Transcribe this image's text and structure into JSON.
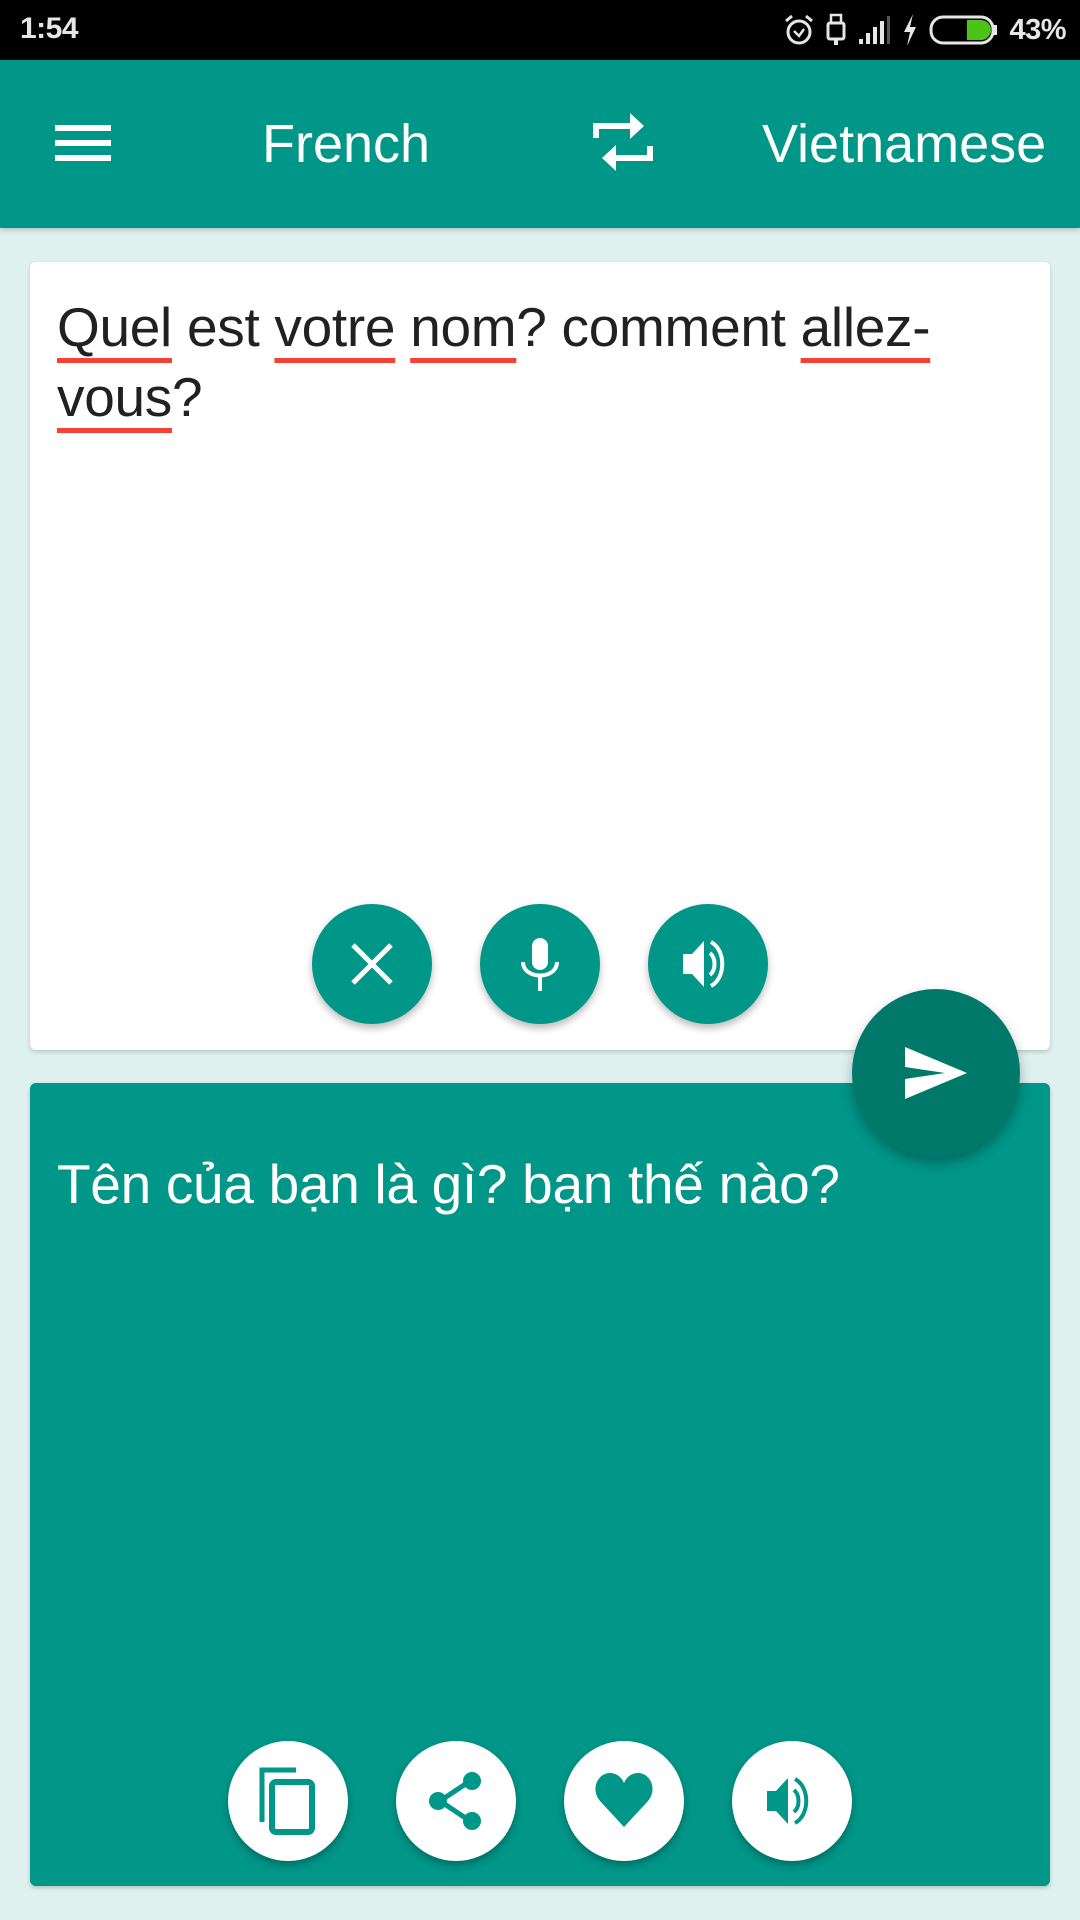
{
  "status_bar": {
    "time": "1:54",
    "icons": [
      "alarm-icon",
      "usb-icon",
      "signal-icon",
      "charging-icon",
      "battery-icon"
    ],
    "battery_percent": "43%",
    "battery_level": 0.43,
    "battery_color": "#4CC417"
  },
  "toolbar": {
    "menu_icon": "hamburger-menu-icon",
    "source_language": "French",
    "swap_icon": "swap-languages-icon",
    "target_language": "Vietnamese",
    "background": "#009688"
  },
  "input": {
    "segments": [
      {
        "text": "Quel",
        "misspelled": true
      },
      {
        "text": " est ",
        "misspelled": false
      },
      {
        "text": "votre",
        "misspelled": true
      },
      {
        "text": " ",
        "misspelled": false
      },
      {
        "text": "nom",
        "misspelled": true
      },
      {
        "text": "? comment ",
        "misspelled": false
      },
      {
        "text": "allez-",
        "misspelled": true
      },
      {
        "text": "vous",
        "misspelled": true
      },
      {
        "text": "?",
        "misspelled": false
      }
    ],
    "full_text": "Quel est votre nom? comment allez-vous?",
    "actions": [
      {
        "name": "clear",
        "icon": "close-icon"
      },
      {
        "name": "voice-input",
        "icon": "microphone-icon"
      },
      {
        "name": "speak-source",
        "icon": "speaker-icon"
      }
    ]
  },
  "translate_button": {
    "icon": "send-icon",
    "color": "#00796B"
  },
  "output": {
    "text": "Tên của bạn là gì? bạn thế nào?",
    "actions": [
      {
        "name": "copy",
        "icon": "copy-icon"
      },
      {
        "name": "share",
        "icon": "share-icon"
      },
      {
        "name": "favorite",
        "icon": "heart-icon"
      },
      {
        "name": "speak-translation",
        "icon": "speaker-icon"
      }
    ]
  },
  "colors": {
    "primary": "#009688",
    "primary_dark": "#00796B",
    "background": "#DFF1EF",
    "spellcheck_underline": "#F44336"
  }
}
